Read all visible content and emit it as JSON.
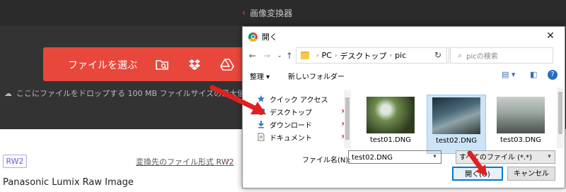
{
  "page": {
    "breadcrumb": "画像変換器",
    "choose_file_label": "ファイルを選ぶ",
    "drop_text": "ここにファイルをドロップする 100 MB ファイルサイズの最大値",
    "format_badge": "RW2",
    "format_link": "変換先のファイル形式 RW2",
    "format_title": "Panasonic Lumix Raw Image",
    "icons": [
      "folder-search-icon",
      "dropbox-icon",
      "google-drive-icon"
    ],
    "accent_color": "#e8473c"
  },
  "dialog": {
    "title": "開く",
    "address_parts": [
      "PC",
      "デスクトップ",
      "pic"
    ],
    "search_placeholder": "picの検索",
    "organize_label": "整理 ▾",
    "new_folder_label": "新しいフォルダー",
    "nav_items": [
      {
        "label": "クイック アクセス",
        "icon": "star-icon"
      },
      {
        "label": "デスクトップ",
        "icon": "desktop-icon"
      },
      {
        "label": "ダウンロード",
        "icon": "download-icon"
      },
      {
        "label": "ドキュメント",
        "icon": "document-icon"
      }
    ],
    "files": [
      {
        "name": "test01.DNG",
        "selected": false
      },
      {
        "name": "test02.DNG",
        "selected": true
      },
      {
        "name": "test03.DNG",
        "selected": false
      }
    ],
    "filename_label": "ファイル名(N):",
    "filename_value": "test02.DNG",
    "filetype_value": "すべてのファイル (*.*)",
    "open_label": "開く(O)",
    "cancel_label": "キャンセル"
  }
}
